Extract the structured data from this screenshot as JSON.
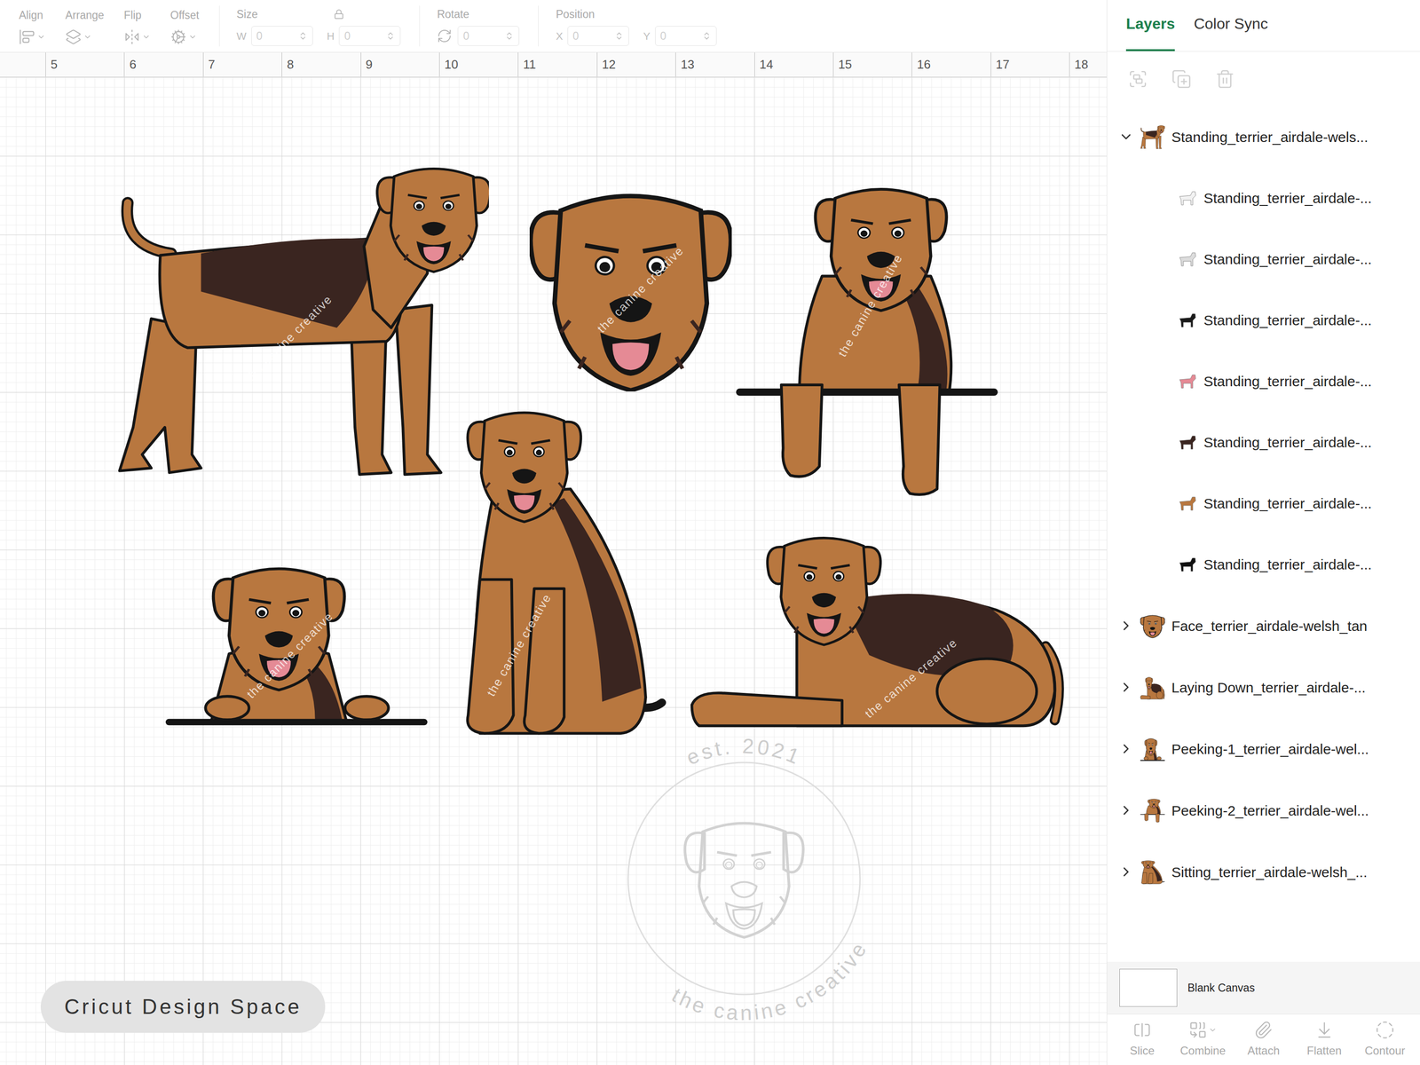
{
  "toolbar": {
    "disabled": true,
    "tools": [
      {
        "label": "Align"
      },
      {
        "label": "Arrange"
      },
      {
        "label": "Flip"
      },
      {
        "label": "Offset"
      }
    ],
    "size": {
      "label": "Size",
      "fields": [
        {
          "label": "W",
          "value": "0"
        },
        {
          "label": "H",
          "value": "0"
        }
      ]
    },
    "rotate": {
      "label": "Rotate",
      "value": "0"
    },
    "position": {
      "label": "Position",
      "fields": [
        {
          "label": "X",
          "value": "0"
        },
        {
          "label": "Y",
          "value": "0"
        }
      ]
    }
  },
  "ruler": [
    "5",
    "6",
    "7",
    "8",
    "9",
    "10",
    "11",
    "12",
    "13",
    "14",
    "15",
    "16",
    "17",
    "18"
  ],
  "canvas": {
    "designs": [
      {
        "kind": "standing"
      },
      {
        "kind": "face"
      },
      {
        "kind": "peeking2"
      },
      {
        "kind": "peeking1"
      },
      {
        "kind": "sitting"
      },
      {
        "kind": "laying"
      }
    ],
    "mark": "the canine creative",
    "watermark": {
      "top": "est. 2021",
      "bottom": "the canine creative"
    },
    "app_label": "Cricut Design Space"
  },
  "panel": {
    "tabs": [
      {
        "label": "Layers",
        "selected": true
      },
      {
        "label": "Color Sync",
        "selected": false
      }
    ],
    "actions_disabled": true,
    "layers": [
      {
        "name": "Standing_terrier_airdale-wels...",
        "design": "standing",
        "expanded": true,
        "children": [
          {
            "name": "Standing_terrier_airdale-...",
            "color": "#f2f2f2"
          },
          {
            "name": "Standing_terrier_airdale-...",
            "color": "#dcdcdc"
          },
          {
            "name": "Standing_terrier_airdale-...",
            "color": "#1a1a1a"
          },
          {
            "name": "Standing_terrier_airdale-...",
            "color": "#e58a95"
          },
          {
            "name": "Standing_terrier_airdale-...",
            "color": "#3a2520"
          },
          {
            "name": "Standing_terrier_airdale-...",
            "color": "#b8773f"
          },
          {
            "name": "Standing_terrier_airdale-...",
            "color": "#111111"
          }
        ]
      },
      {
        "name": "Face_terrier_airdale-welsh_tan",
        "design": "face",
        "expanded": false,
        "children": []
      },
      {
        "name": "Laying Down_terrier_airdale-...",
        "design": "laying",
        "expanded": false,
        "children": []
      },
      {
        "name": "Peeking-1_terrier_airdale-wel...",
        "design": "peeking1",
        "expanded": false,
        "children": []
      },
      {
        "name": "Peeking-2_terrier_airdale-wel...",
        "design": "peeking2",
        "expanded": false,
        "children": []
      },
      {
        "name": "Sitting_terrier_airdale-welsh_...",
        "design": "sitting",
        "expanded": false,
        "children": []
      }
    ],
    "canvas_row": {
      "label": "Blank Canvas"
    },
    "bottom_actions": [
      {
        "label": "Slice",
        "disabled": true,
        "has_menu": false
      },
      {
        "label": "Combine",
        "disabled": true,
        "has_menu": true
      },
      {
        "label": "Attach",
        "disabled": true,
        "has_menu": false
      },
      {
        "label": "Flatten",
        "disabled": true,
        "has_menu": false
      },
      {
        "label": "Contour",
        "disabled": true,
        "has_menu": false
      }
    ]
  }
}
